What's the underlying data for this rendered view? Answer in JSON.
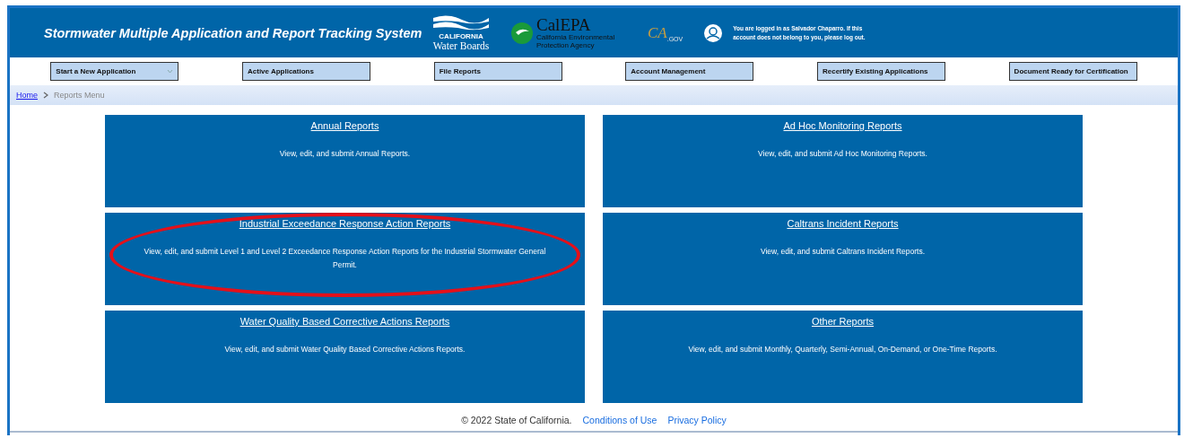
{
  "header": {
    "title": "Stormwater Multiple Application and Report Tracking System",
    "logos": [
      {
        "kind": "waterboards",
        "small": "CALIFORNIA",
        "name": "Water Boards"
      },
      {
        "kind": "calepa",
        "name": "CalEPA",
        "sub": "California Environmental Protection Agency"
      },
      {
        "kind": "cagov",
        "name": "CA",
        "sub": ".GOV"
      }
    ],
    "user_notice": "You are logged in as Salvador Chaparro. If this account does not belong to you, please log out."
  },
  "nav": [
    {
      "label": "Start a New Application",
      "kind": "dropdown"
    },
    {
      "label": "Active Applications",
      "kind": "button"
    },
    {
      "label": "File Reports",
      "kind": "button"
    },
    {
      "label": "Account Management",
      "kind": "button"
    },
    {
      "label": "Recertify Existing Applications",
      "kind": "button"
    },
    {
      "label": "Document Ready for Certification",
      "kind": "button"
    }
  ],
  "breadcrumb": [
    {
      "label": "Home",
      "link": true
    },
    {
      "label": "Reports Menu",
      "link": false
    }
  ],
  "cards": [
    {
      "title": "Annual Reports",
      "description": "View, edit, and submit Annual Reports.",
      "highlighted": false
    },
    {
      "title": "Ad Hoc Monitoring Reports",
      "description": "View, edit, and submit Ad Hoc Monitoring Reports.",
      "highlighted": false
    },
    {
      "title": "Industrial Exceedance Response Action Reports",
      "description": "View, edit, and submit Level 1 and Level 2 Exceedance Response Action Reports for the Industrial Stormwater General Permit.",
      "highlighted": true
    },
    {
      "title": "Caltrans Incident Reports",
      "description": "View, edit, and submit Caltrans Incident Reports.",
      "highlighted": false
    },
    {
      "title": "Water Quality Based Corrective Actions Reports",
      "description": "View, edit, and submit Water Quality Based Corrective Actions Reports.",
      "highlighted": false
    },
    {
      "title": "Other Reports",
      "description": "View, edit, and submit Monthly, Quarterly, Semi-Annual, On-Demand, or One-Time Reports.",
      "highlighted": false
    }
  ],
  "footer": {
    "copyright": "© 2022 State of California.",
    "links": [
      "Conditions of Use",
      "Privacy Policy"
    ]
  }
}
